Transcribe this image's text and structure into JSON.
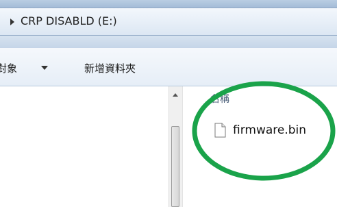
{
  "address_bar": {
    "path": "CRP DISABLD (E:)"
  },
  "toolbar": {
    "items": [
      {
        "label": "對象"
      },
      {
        "label": "新增資料夾"
      }
    ]
  },
  "file_list": {
    "column_header": "名稱",
    "files": [
      {
        "name": "firmware.bin",
        "icon": "file-icon"
      }
    ]
  },
  "annotation": {
    "shape": "ellipse",
    "color": "#1aa34a"
  }
}
